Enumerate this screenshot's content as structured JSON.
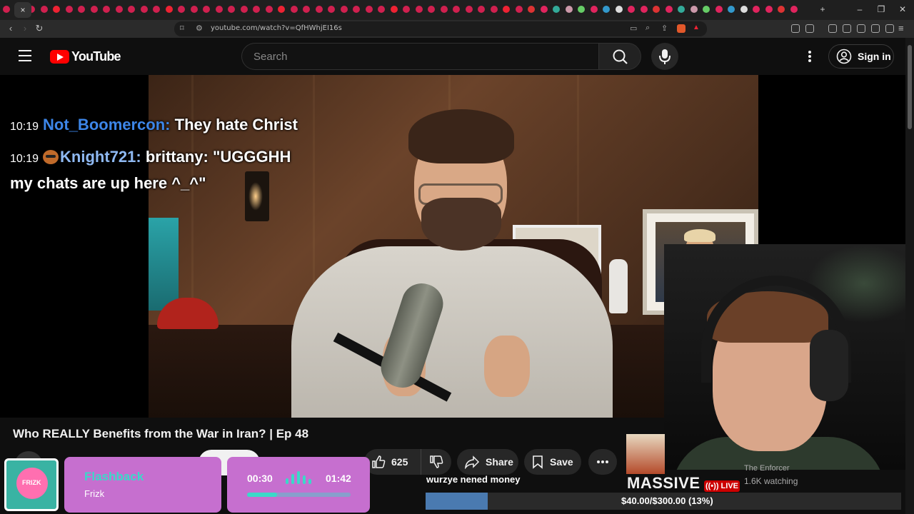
{
  "browser": {
    "url": "youtube.com/watch?v=QfHWhjEI16s",
    "close_tab_glyph": "×",
    "new_tab_glyph": "+",
    "window_controls": [
      "–",
      "❐",
      "✕"
    ]
  },
  "youtube": {
    "logo_text": "YouTube",
    "search_placeholder": "Search",
    "signin_label": "Sign in"
  },
  "chat": [
    {
      "time": "10:19",
      "user": "Not_Boomercon:",
      "message": "They hate Christ"
    },
    {
      "time": "10:19",
      "user": "Knight721:",
      "message": "brittany: \"UGGGHH my chats are up here ^_^\""
    }
  ],
  "video": {
    "title": "Who REALLY Benefits from the War in Iran? | Ep 48",
    "like_count": "625",
    "share_label": "Share",
    "save_label": "Save"
  },
  "music_widget": {
    "song": "Flashback",
    "artist": "Frizk",
    "current_time": "00:30",
    "total_time": "01:42",
    "progress_fraction": 0.29,
    "art_label": "FRIZK"
  },
  "donation": {
    "message": "wurzye nened money",
    "goal_text": "$40.00/$300.00 (13%)",
    "goal_fraction": 0.13
  },
  "recommended": {
    "title_text": "MASSIVE",
    "live_badge": "((•)) LIVE",
    "channel": "The Enforcer",
    "watching": "1.6K watching"
  },
  "colors": {
    "youtube_red": "#ff0000",
    "chat_user_1": "#3d86e8",
    "chat_user_2": "#8fb9f2",
    "widget_pink": "#c66fcf",
    "widget_teal": "#3ad9c8",
    "goal_blue": "#4a7ab0"
  }
}
